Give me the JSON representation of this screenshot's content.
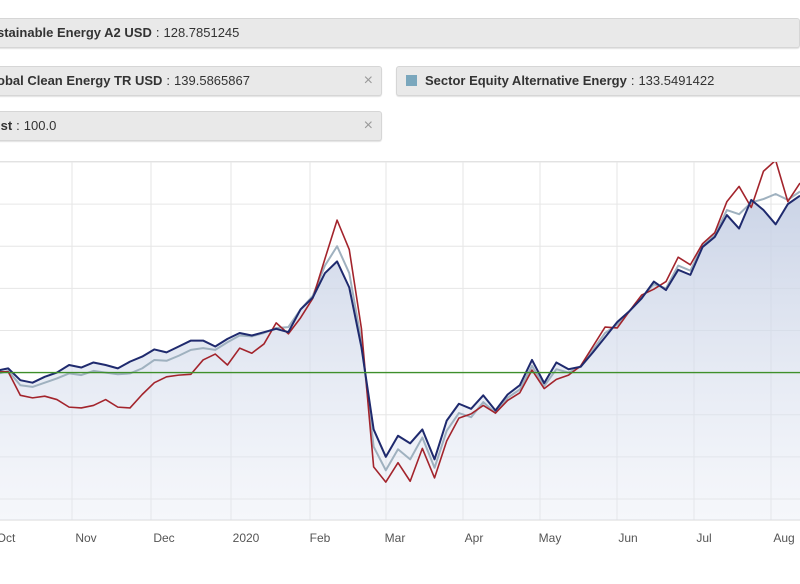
{
  "legend": {
    "items": [
      {
        "name": "stainable Energy A2 USD",
        "sep": ":",
        "value": "128.7851245"
      },
      {
        "name": "obal Clean Energy TR USD",
        "sep": ":",
        "value": "139.5865867",
        "close": "×"
      },
      {
        "name": "Sector Equity Alternative Energy",
        "sep": ":",
        "value": "133.5491422",
        "swatch_color": "#7aa7bd"
      },
      {
        "name": "ist",
        "sep": ":",
        "value": "100.0",
        "close": "×"
      }
    ]
  },
  "chart_data": {
    "type": "line",
    "x_tick_labels": [
      "Oct",
      "Nov",
      "Dec",
      "2020",
      "Feb",
      "Mar",
      "Apr",
      "May",
      "Jun",
      "Jul",
      "Aug"
    ],
    "y_range": [
      65,
      150
    ],
    "grid": true,
    "baseline": 100,
    "colors": {
      "navy": "#1f2a6e",
      "red": "#a3242c",
      "gray": "#9fb1bf",
      "baseline": "#3f8f2b",
      "area": "#e3e8f3",
      "grid": "#e6e6e6"
    },
    "series": [
      {
        "color_key": "navy",
        "values": [
          100.4,
          101.0,
          98.2,
          97.6,
          99.0,
          100.0,
          101.8,
          101.2,
          102.4,
          101.8,
          101.0,
          102.6,
          103.8,
          105.5,
          104.8,
          106.2,
          107.6,
          107.6,
          106.2,
          108.0,
          109.4,
          108.8,
          109.6,
          110.4,
          109.6,
          115.0,
          117.8,
          123.6,
          126.4,
          120.2,
          106.0,
          86.5,
          80.0,
          85.0,
          83.2,
          86.5,
          79.4,
          88.6,
          92.6,
          91.4,
          94.6,
          91.0,
          94.8,
          97.0,
          103.0,
          97.5,
          102.4,
          100.8,
          101.4,
          104.8,
          108.4,
          112.0,
          114.6,
          117.6,
          121.6,
          119.6,
          124.4,
          123.2,
          129.8,
          132.2,
          137.4,
          134.2,
          141.0,
          138.6,
          135.2,
          140.0,
          142.0
        ]
      },
      {
        "color_key": "red",
        "values": [
          100.2,
          100.2,
          94.6,
          94.0,
          94.4,
          93.6,
          91.8,
          91.6,
          92.2,
          93.6,
          91.8,
          91.6,
          94.8,
          97.6,
          99.0,
          99.4,
          99.6,
          103.0,
          104.4,
          101.8,
          105.8,
          104.6,
          106.8,
          111.8,
          109.2,
          113.0,
          117.6,
          127.0,
          136.2,
          129.2,
          110.4,
          77.6,
          74.0,
          78.6,
          74.2,
          82.0,
          75.0,
          83.8,
          89.2,
          90.2,
          92.2,
          90.4,
          93.4,
          95.2,
          100.6,
          96.2,
          98.4,
          99.4,
          101.6,
          106.2,
          110.8,
          110.6,
          114.6,
          118.4,
          119.8,
          121.6,
          127.4,
          125.6,
          130.6,
          133.2,
          140.6,
          144.2,
          139.2,
          147.8,
          150.4,
          140.6,
          145.0
        ]
      },
      {
        "color_key": "gray",
        "values": [
          99.6,
          100.4,
          97.0,
          96.6,
          97.6,
          98.6,
          99.8,
          99.4,
          100.4,
          100.0,
          99.6,
          99.8,
          101.0,
          103.0,
          102.8,
          104.0,
          105.4,
          105.8,
          105.4,
          107.2,
          108.8,
          108.6,
          109.4,
          110.6,
          110.8,
          115.0,
          118.2,
          125.4,
          130.0,
          123.6,
          107.4,
          82.4,
          76.8,
          81.8,
          79.4,
          84.6,
          77.4,
          86.2,
          90.4,
          89.4,
          93.0,
          90.4,
          94.0,
          96.0,
          101.6,
          96.8,
          100.8,
          100.0,
          101.4,
          105.4,
          109.4,
          111.4,
          114.6,
          117.8,
          121.0,
          120.0,
          125.4,
          124.2,
          130.2,
          132.6,
          138.6,
          137.6,
          140.4,
          141.2,
          142.4,
          141.0,
          143.0
        ]
      },
      {
        "color_key": "baseline",
        "values": [
          100.0,
          100.0
        ]
      }
    ]
  }
}
